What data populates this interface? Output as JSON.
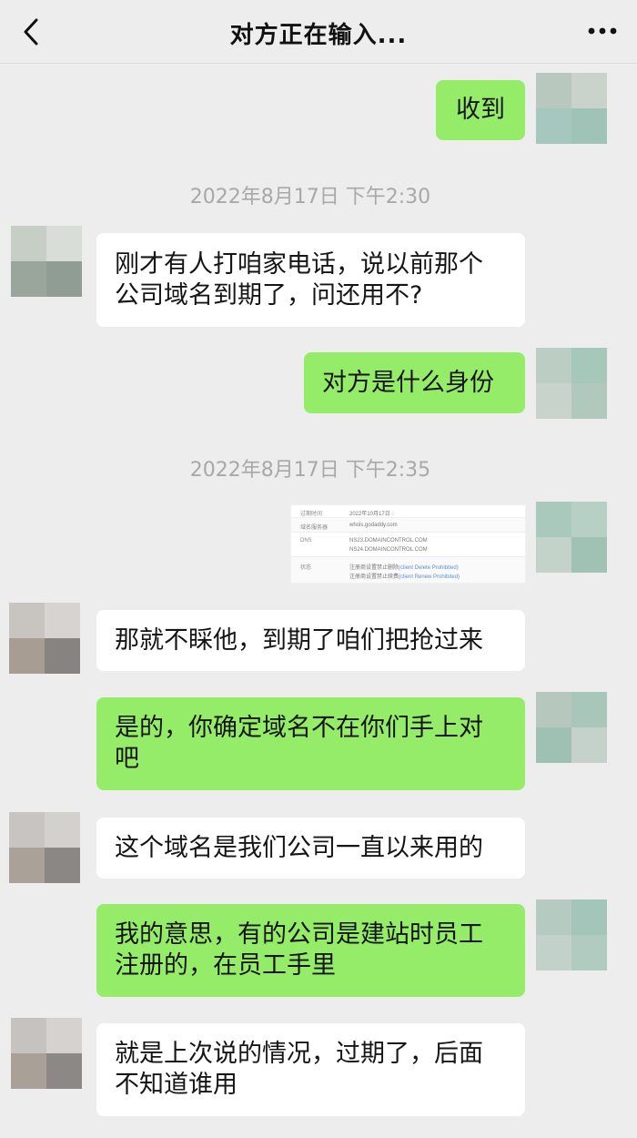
{
  "header": {
    "title": "对方正在输入...",
    "back_icon": "chevron-left-icon",
    "more_icon": "more-dots-icon"
  },
  "timestamps": [
    "2022年8月17日 下午2:30",
    "2022年8月17日 下午2:35"
  ],
  "messages": [
    {
      "side": "out",
      "text": "收到"
    },
    {
      "side": "in",
      "text": "刚才有人打咱家电话，说以前那个公司域名到期了，问还用不?"
    },
    {
      "side": "out",
      "text": "对方是什么身份"
    },
    {
      "side": "out",
      "type": "image"
    },
    {
      "side": "in",
      "text": "那就不睬他，到期了咱们把抢过来"
    },
    {
      "side": "out",
      "text": "是的，你确定域名不在你们手上对吧"
    },
    {
      "side": "in",
      "text": "这个域名是我们公司一直以来用的"
    },
    {
      "side": "out",
      "text": "我的意思，有的公司是建站时员工注册的，在员工手里"
    },
    {
      "side": "in",
      "text": "就是上次说的情况，过期了，后面不知道谁用"
    }
  ],
  "screenshot": {
    "rows": [
      {
        "key": "过期时间",
        "values": [
          "2022年10月17日 ◌"
        ]
      },
      {
        "key": "域名服务器",
        "values": [
          "whois.godaddy.com"
        ]
      },
      {
        "key": "DNS",
        "values": [
          "NS23.DOMAINCONTROL.COM",
          "NS24.DOMAINCONTROL.COM"
        ]
      },
      {
        "key": "状态",
        "values": [
          "注册商设置禁止删除",
          "注册商设置禁止续费"
        ],
        "links": [
          "(client Delete Prohibited)",
          "(client Renew Prohibited)"
        ]
      }
    ]
  },
  "colors": {
    "background": "#ededed",
    "outgoing_bubble": "#95ec69",
    "incoming_bubble": "#ffffff",
    "timestamp": "#a8a8a8"
  }
}
